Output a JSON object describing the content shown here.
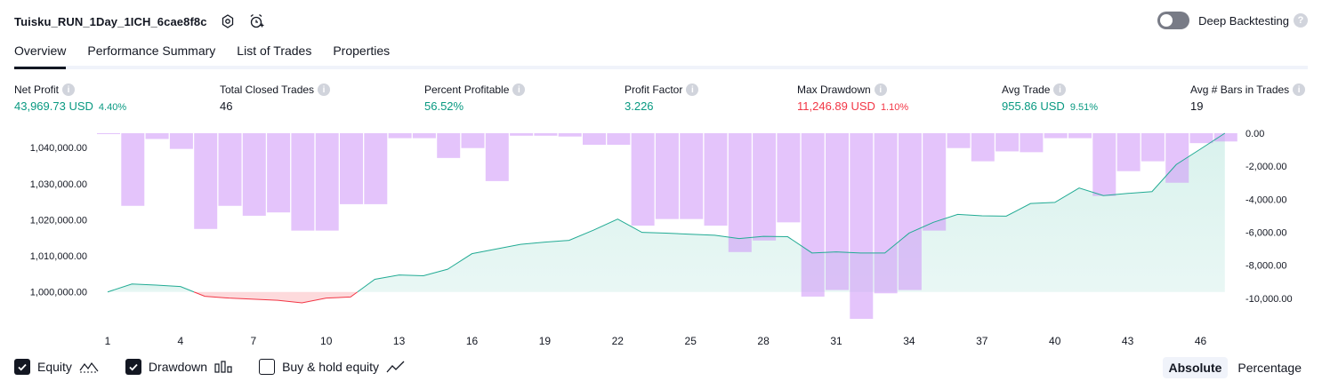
{
  "header": {
    "strategy_name": "Tuisku_RUN_1Day_1ICH_6cae8f8c",
    "icons": [
      "settings-icon",
      "alarm-add-icon"
    ]
  },
  "deep_backtesting": {
    "label": "Deep Backtesting",
    "enabled": false,
    "help": "?"
  },
  "tabs": [
    {
      "label": "Overview",
      "active": true
    },
    {
      "label": "Performance Summary",
      "active": false
    },
    {
      "label": "List of Trades",
      "active": false
    },
    {
      "label": "Properties",
      "active": false
    }
  ],
  "stats": {
    "net_profit": {
      "label": "Net Profit",
      "value": "43,969.73 USD",
      "pct": "4.40%"
    },
    "total_closed_trades": {
      "label": "Total Closed Trades",
      "value": "46"
    },
    "percent_profitable": {
      "label": "Percent Profitable",
      "value": "56.52%"
    },
    "profit_factor": {
      "label": "Profit Factor",
      "value": "3.226"
    },
    "max_drawdown": {
      "label": "Max Drawdown",
      "value": "11,246.89 USD",
      "pct": "1.10%"
    },
    "avg_trade": {
      "label": "Avg Trade",
      "value": "955.86 USD",
      "pct": "9.51%"
    },
    "avg_bars": {
      "label": "Avg # Bars in Trades",
      "value": "19"
    }
  },
  "info_glyph": "i",
  "colors": {
    "equity_line": "#22ab94",
    "equity_fill": "#d7f1ec",
    "below_line": "#f23645",
    "below_fill": "#fccbcd",
    "drawdown_bar": "#ce93f8",
    "text": "#131722",
    "grid_text": "#131722"
  },
  "chart_data": {
    "type": "area",
    "x_ticks": [
      "1",
      "4",
      "7",
      "10",
      "13",
      "16",
      "19",
      "22",
      "25",
      "28",
      "31",
      "34",
      "37",
      "40",
      "43",
      "46"
    ],
    "trade_numbers": [
      1,
      2,
      3,
      4,
      5,
      6,
      7,
      8,
      9,
      10,
      11,
      12,
      13,
      14,
      15,
      16,
      17,
      18,
      19,
      20,
      21,
      22,
      23,
      24,
      25,
      26,
      27,
      28,
      29,
      30,
      31,
      32,
      33,
      34,
      35,
      36,
      37,
      38,
      39,
      40,
      41,
      42,
      43,
      44,
      45,
      46,
      47
    ],
    "series": [
      {
        "name": "Equity",
        "axis": "left",
        "values": [
          1000000,
          1002200,
          1001900,
          1001500,
          998800,
          998300,
          998000,
          997700,
          997000,
          998300,
          998600,
          1003500,
          1004700,
          1004500,
          1006300,
          1010600,
          1011900,
          1013200,
          1013800,
          1014300,
          1017100,
          1020200,
          1016500,
          1016300,
          1016000,
          1015700,
          1014800,
          1015400,
          1015300,
          1010800,
          1011100,
          1010800,
          1010800,
          1016300,
          1019300,
          1021500,
          1021100,
          1021000,
          1024500,
          1024800,
          1028800,
          1026700,
          1027300,
          1027800,
          1035300,
          1039600,
          1043970
        ]
      },
      {
        "name": "Drawdown",
        "axis": "right",
        "values": [
          0,
          -4400,
          -350,
          -950,
          -5800,
          -4400,
          -5000,
          -4800,
          -5900,
          -5900,
          -4300,
          -4300,
          -300,
          -300,
          -1500,
          -900,
          -2900,
          -150,
          -150,
          -200,
          -700,
          -700,
          -5600,
          -5200,
          -5200,
          -5600,
          -7200,
          -6500,
          -5400,
          -9900,
          -9500,
          -11246.89,
          -9700,
          -9500,
          -5900,
          -900,
          -1700,
          -1100,
          -1150,
          -300,
          -300,
          -3800,
          -2300,
          -1700,
          -3000,
          -600,
          -500
        ]
      }
    ],
    "y_left_ticks": [
      "1,000,000.00",
      "1,010,000.00",
      "1,020,000.00",
      "1,030,000.00",
      "1,040,000.00"
    ],
    "y_left_range": [
      996000,
      1043970
    ],
    "y_right_ticks": [
      "0.00",
      "-2,000.00",
      "-4,000.00",
      "-6,000.00",
      "-8,000.00",
      "-10,000.00"
    ],
    "y_right_range": [
      -11246.89,
      0
    ],
    "baseline": 1000000,
    "grid": false
  },
  "legend": [
    {
      "label": "Equity",
      "checked": true,
      "icon": "equity-line-icon"
    },
    {
      "label": "Drawdown",
      "checked": true,
      "icon": "drawdown-bars-icon"
    },
    {
      "label": "Buy & hold equity",
      "checked": false,
      "icon": "buy-hold-line-icon"
    }
  ],
  "view_modes": [
    {
      "label": "Absolute",
      "active": true
    },
    {
      "label": "Percentage",
      "active": false
    }
  ]
}
